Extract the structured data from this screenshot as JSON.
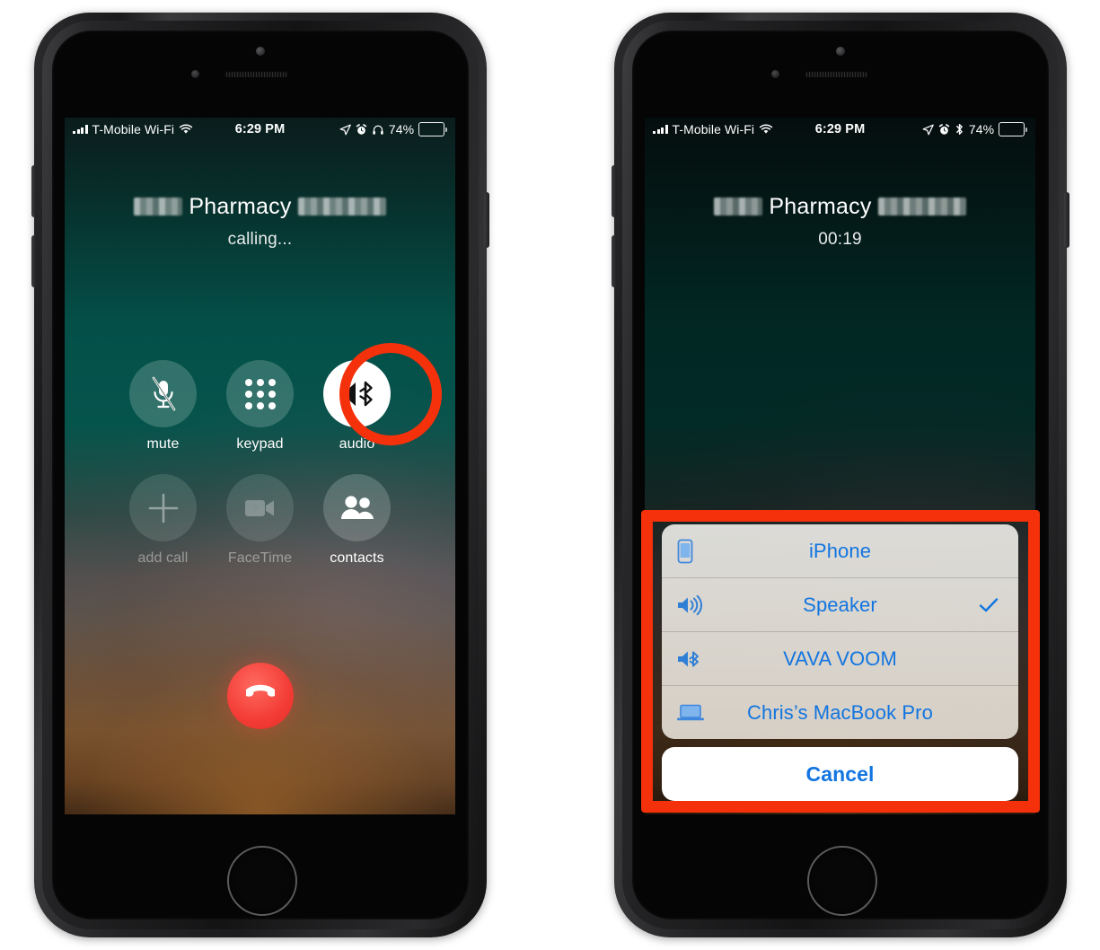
{
  "status_bar": {
    "carrier": "T-Mobile Wi-Fi",
    "time": "6:29 PM",
    "battery_percent": "74%",
    "icons_left": [
      "signal-bars-icon",
      "wifi-icon"
    ],
    "icons_right_phone1": [
      "location-arrow-icon",
      "alarm-clock-icon",
      "headphones-icon",
      "battery-icon"
    ],
    "icons_right_phone2": [
      "location-arrow-icon",
      "alarm-clock-icon",
      "bluetooth-icon",
      "battery-icon"
    ]
  },
  "phone_left": {
    "call": {
      "callee_name": "Pharmacy",
      "callee_redacted_before": true,
      "callee_redacted_after": true,
      "status": "calling..."
    },
    "controls_row1": [
      {
        "label": "mute",
        "icon": "microphone-slash-icon",
        "state": "enabled"
      },
      {
        "label": "keypad",
        "icon": "keypad-dots-icon",
        "state": "enabled"
      },
      {
        "label": "audio",
        "icon": "speaker-bluetooth-icon",
        "state": "selected"
      }
    ],
    "controls_row2": [
      {
        "label": "add call",
        "icon": "plus-icon",
        "state": "disabled"
      },
      {
        "label": "FaceTime",
        "icon": "video-camera-icon",
        "state": "disabled"
      },
      {
        "label": "contacts",
        "icon": "people-icon",
        "state": "enabled"
      }
    ],
    "end_call": {
      "icon": "hang-up-handset-icon",
      "color": "#f23b34"
    },
    "annotation": {
      "type": "circle-highlight",
      "color": "#f5310b",
      "target": "audio"
    }
  },
  "phone_right": {
    "call": {
      "callee_name": "Pharmacy",
      "callee_redacted_before": true,
      "callee_redacted_after": true,
      "status": "00:19"
    },
    "action_sheet": {
      "options": [
        {
          "label": "iPhone",
          "icon": "iphone-icon",
          "checked": false
        },
        {
          "label": "Speaker",
          "icon": "speaker-waves-icon",
          "checked": true
        },
        {
          "label": "VAVA VOOM",
          "icon": "speaker-bluetooth-icon",
          "checked": false
        },
        {
          "label": "Chris’s MacBook Pro",
          "icon": "laptop-icon",
          "checked": false
        }
      ],
      "cancel_label": "Cancel",
      "accent_color": "#1275e0"
    },
    "annotation": {
      "type": "box-highlight",
      "color": "#f5310b",
      "target": "action-sheet"
    }
  }
}
